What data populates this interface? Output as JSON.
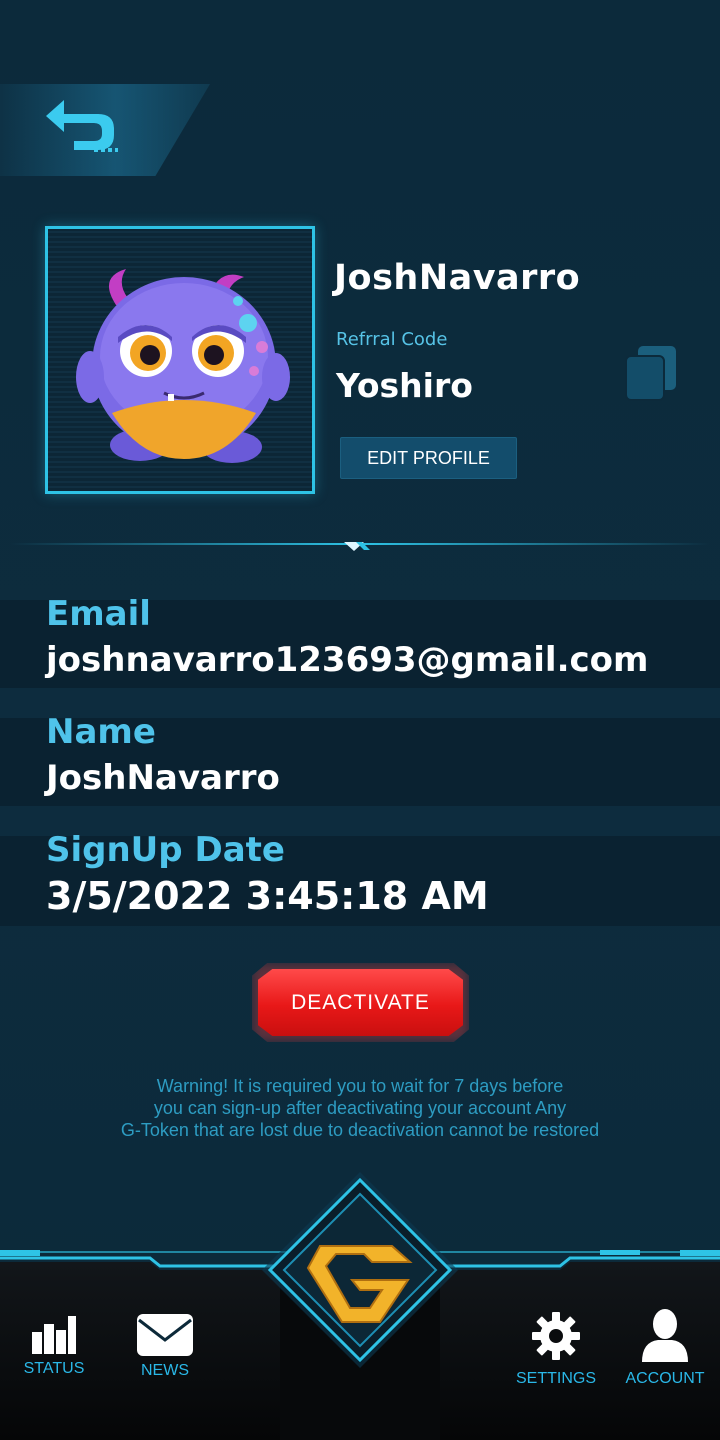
{
  "profile": {
    "username": "JoshNavarro",
    "referral_label": "Refrral Code",
    "referral_code": "Yoshiro",
    "edit_button": "EDIT PROFILE"
  },
  "info": [
    {
      "label": "Email",
      "value": "joshnavarro123693@gmail.com"
    },
    {
      "label": "Name",
      "value": "JoshNavarro"
    },
    {
      "label": "SignUp Date",
      "value": "3/5/2022 3:45:18 AM"
    }
  ],
  "deactivate_button": "DEACTIVATE",
  "warning_lines": [
    "Warning! It is required you to wait for 7 days before",
    "you can sign-up after deactivating your account Any",
    "G-Token that are lost due to deactivation cannot be restored"
  ],
  "nav": {
    "status": "STATUS",
    "news": "NEWS",
    "settings": "SETTINGS",
    "account": "ACCOUNT"
  },
  "colors": {
    "background": "#0d2a3b",
    "accent": "#2ec3e6",
    "label_blue": "#4fc3ea",
    "danger": "#e81818",
    "gold": "#f2b32a"
  }
}
